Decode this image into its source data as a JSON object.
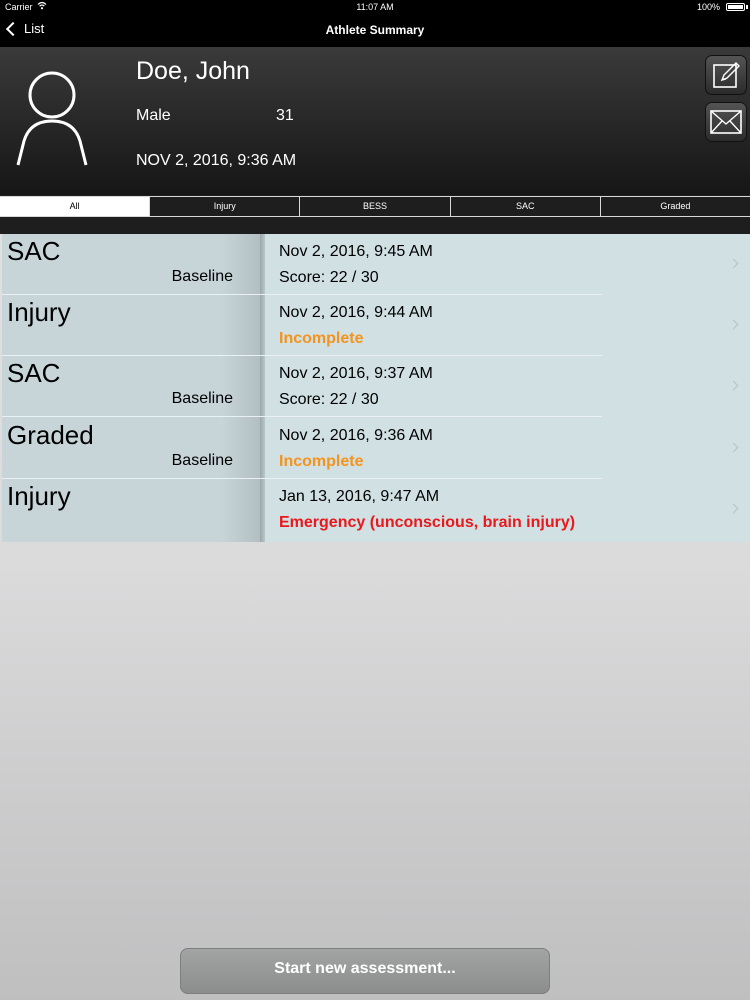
{
  "status_bar": {
    "carrier": "Carrier",
    "time": "11:07 AM",
    "battery": "100%"
  },
  "nav": {
    "back_label": "List",
    "title": "Athlete Summary"
  },
  "athlete": {
    "name": "Doe, John",
    "gender": "Male",
    "age": "31",
    "date": "NOV 2, 2016, 9:36 AM"
  },
  "tabs": [
    {
      "label": "All",
      "active": true
    },
    {
      "label": "Injury",
      "active": false
    },
    {
      "label": "BESS",
      "active": false
    },
    {
      "label": "SAC",
      "active": false
    },
    {
      "label": "Graded",
      "active": false
    }
  ],
  "assessments": [
    {
      "type": "SAC",
      "subtype": "Baseline",
      "date": "Nov 2, 2016, 9:45 AM",
      "status": "Score: 22 / 30",
      "status_style": "normal"
    },
    {
      "type": "Injury",
      "subtype": "",
      "date": "Nov 2, 2016, 9:44 AM",
      "status": "Incomplete",
      "status_style": "orange"
    },
    {
      "type": "SAC",
      "subtype": "Baseline",
      "date": "Nov 2, 2016, 9:37 AM",
      "status": "Score: 22 / 30",
      "status_style": "normal"
    },
    {
      "type": "Graded",
      "subtype": "Baseline",
      "date": "Nov 2, 2016, 9:36 AM",
      "status": "Incomplete",
      "status_style": "orange"
    },
    {
      "type": "Injury",
      "subtype": "",
      "date": "Jan 13, 2016, 9:47 AM",
      "status": "Emergency (unconscious, brain injury)",
      "status_style": "red"
    }
  ],
  "actions": {
    "start_label": "Start new assessment..."
  },
  "colors": {
    "orange": "#f5941d",
    "red": "#e8181c",
    "list_bg": "#d0e0e3"
  },
  "icons": {
    "edit": "edit-icon",
    "mail": "mail-icon",
    "avatar": "person-icon"
  }
}
